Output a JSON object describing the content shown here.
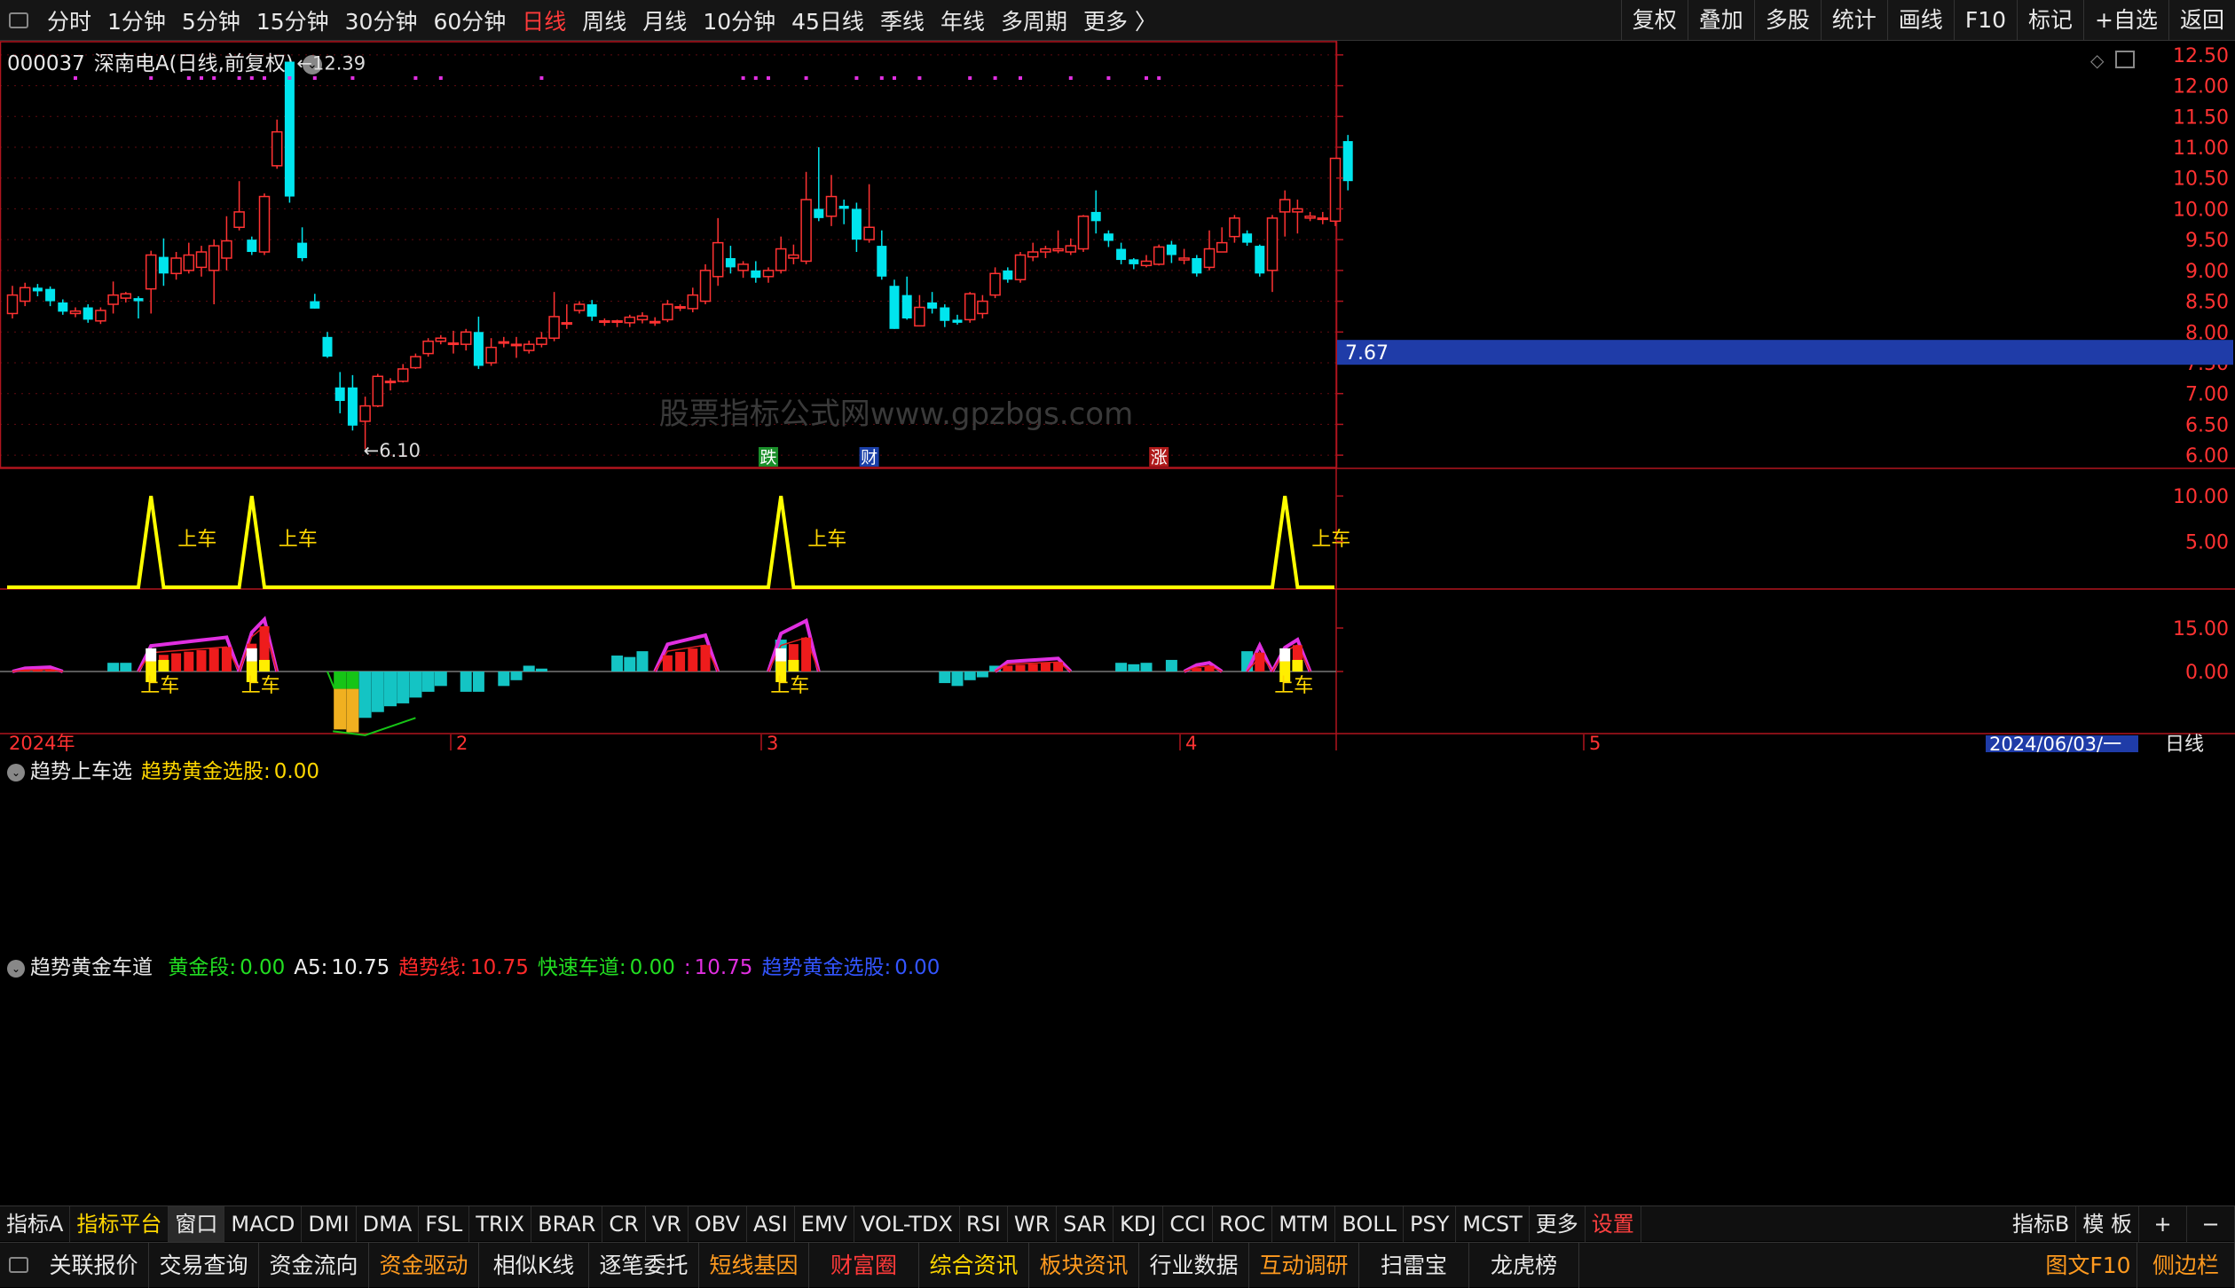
{
  "topbar": {
    "periods": [
      "分时",
      "1分钟",
      "5分钟",
      "15分钟",
      "30分钟",
      "60分钟",
      "日线",
      "周线",
      "月线",
      "10分钟",
      "45日线",
      "季线",
      "年线",
      "多周期",
      "更多 〉"
    ],
    "active_period": "日线",
    "right_buttons": [
      "复权",
      "叠加",
      "多股",
      "统计",
      "画线",
      "F10",
      "标记",
      "+自选",
      "返回"
    ]
  },
  "main_chart": {
    "code": "000037",
    "name": "深南电A",
    "mode": "(日线,前复权)",
    "high_mark": "12.39",
    "low_mark": "6.10",
    "current_price_tag": "7.67",
    "watermark": "股票指标公式网www.gpzbgs.com",
    "event_tags": [
      {
        "text": "跌",
        "color": "#1a8f2a",
        "index": 60
      },
      {
        "text": "财",
        "color": "#1a3fa8",
        "index": 68
      },
      {
        "text": "涨",
        "color": "#b01a1a",
        "index": 91
      }
    ],
    "price_ticks": [
      "12.50",
      "12.00",
      "11.50",
      "11.00",
      "10.50",
      "10.00",
      "9.50",
      "9.00",
      "8.50",
      "8.00",
      "7.50",
      "7.00",
      "6.50",
      "6.00"
    ],
    "colors": {
      "up": "#ff3232",
      "down": "#00e5ee",
      "axis": "#b0141e",
      "magenta": "#e02fe0"
    }
  },
  "panel1": {
    "title": "趋势上车选",
    "label": "趋势黄金选股:",
    "value": "0.00",
    "signal_text": "上车",
    "y_ticks": [
      "10.00",
      "5.00"
    ],
    "line_color": "#ffff00"
  },
  "panel2": {
    "title": "趋势黄金车道",
    "items": [
      {
        "label": "黄金段:",
        "value": "0.00",
        "color": "#22dd22"
      },
      {
        "label": "A5:",
        "value": "10.75",
        "color": "#f0f0f0"
      },
      {
        "label": "趋势线:",
        "value": "10.75",
        "color": "#ff2a2a"
      },
      {
        "label": "快速车道:",
        "value": "0.00",
        "color": "#22dd22"
      },
      {
        "label": ":",
        "value": "10.75",
        "color": "#e02fe0"
      },
      {
        "label": "趋势黄金选股:",
        "value": "0.00",
        "color": "#3355ff"
      }
    ],
    "signal_text": "上车",
    "y_ticks": [
      "15.00",
      "0.00"
    ]
  },
  "date_axis": {
    "labels": [
      "2024年",
      "2",
      "3",
      "4",
      "5"
    ],
    "current_date": "2024/06/03/一",
    "period_label": "日线"
  },
  "indicator_bar": {
    "items": [
      "指标A",
      "指标平台",
      "窗口",
      "MACD",
      "DMI",
      "DMA",
      "FSL",
      "TRIX",
      "BRAR",
      "CR",
      "VR",
      "OBV",
      "ASI",
      "EMV",
      "VOL-TDX",
      "RSI",
      "WR",
      "SAR",
      "KDJ",
      "CCI",
      "ROC",
      "MTM",
      "BOLL",
      "PSY",
      "MCST",
      "更多",
      "设置"
    ],
    "right_items": [
      "指标B",
      "模 板",
      "+",
      "−"
    ]
  },
  "bottom_bar": {
    "items": [
      "关联报价",
      "交易查询",
      "资金流向",
      "资金驱动",
      "相似K线",
      "逐笔委托",
      "短线基因",
      "财富圈",
      "综合资讯",
      "板块资讯",
      "行业数据",
      "互动调研",
      "扫雷宝",
      "龙虎榜"
    ],
    "right_items": [
      "图文F10",
      "侧边栏"
    ]
  },
  "chart_data": {
    "type": "candlestick",
    "title": "000037 深南电A (日线,前复权)",
    "y_range": [
      5.8,
      12.7
    ],
    "candles": [
      [
        8.3,
        8.6,
        8.75,
        8.22
      ],
      [
        8.5,
        8.72,
        8.8,
        8.42
      ],
      [
        8.72,
        8.66,
        8.78,
        8.58
      ],
      [
        8.7,
        8.5,
        8.74,
        8.42
      ],
      [
        8.48,
        8.33,
        8.53,
        8.28
      ],
      [
        8.3,
        8.34,
        8.4,
        8.24
      ],
      [
        8.4,
        8.2,
        8.45,
        8.15
      ],
      [
        8.18,
        8.35,
        8.4,
        8.13
      ],
      [
        8.45,
        8.6,
        8.82,
        8.3
      ],
      [
        8.55,
        8.62,
        8.65,
        8.48
      ],
      [
        8.55,
        8.5,
        8.58,
        8.22
      ],
      [
        8.7,
        9.25,
        9.32,
        8.3
      ],
      [
        9.22,
        8.95,
        9.52,
        8.75
      ],
      [
        8.95,
        9.2,
        9.3,
        8.85
      ],
      [
        9.0,
        9.25,
        9.45,
        8.95
      ],
      [
        9.05,
        9.3,
        9.4,
        8.9
      ],
      [
        9.0,
        9.4,
        9.5,
        8.45
      ],
      [
        9.2,
        9.48,
        9.88,
        9.0
      ],
      [
        9.7,
        9.95,
        10.45,
        9.65
      ],
      [
        9.5,
        9.3,
        9.55,
        9.25
      ],
      [
        9.3,
        10.2,
        10.25,
        9.25
      ],
      [
        10.7,
        11.25,
        11.45,
        10.65
      ],
      [
        12.39,
        10.2,
        12.39,
        10.1
      ],
      [
        9.45,
        9.2,
        9.7,
        9.15
      ],
      [
        8.5,
        8.38,
        8.62,
        8.38
      ],
      [
        7.92,
        7.6,
        8.0,
        7.58
      ],
      [
        7.1,
        6.88,
        7.35,
        6.68
      ],
      [
        7.1,
        6.48,
        7.3,
        6.4
      ],
      [
        6.55,
        6.8,
        6.95,
        6.1
      ],
      [
        6.8,
        7.28,
        7.32,
        6.78
      ],
      [
        7.2,
        7.2,
        7.25,
        7.05
      ],
      [
        7.2,
        7.4,
        7.48,
        7.18
      ],
      [
        7.42,
        7.6,
        7.65,
        7.4
      ],
      [
        7.65,
        7.85,
        7.9,
        7.6
      ],
      [
        7.85,
        7.9,
        7.95,
        7.8
      ],
      [
        7.82,
        7.82,
        8.02,
        7.65
      ],
      [
        7.8,
        8.0,
        8.05,
        7.7
      ],
      [
        8.0,
        7.45,
        8.25,
        7.4
      ],
      [
        7.5,
        7.75,
        7.9,
        7.45
      ],
      [
        7.82,
        7.84,
        7.92,
        7.75
      ],
      [
        7.8,
        7.8,
        7.92,
        7.58
      ],
      [
        7.7,
        7.8,
        7.86,
        7.65
      ],
      [
        7.8,
        7.9,
        8.0,
        7.75
      ],
      [
        7.9,
        8.25,
        8.65,
        7.85
      ],
      [
        8.15,
        8.15,
        8.45,
        8.05
      ],
      [
        8.35,
        8.45,
        8.5,
        8.3
      ],
      [
        8.45,
        8.25,
        8.52,
        8.18
      ],
      [
        8.18,
        8.18,
        8.22,
        8.1
      ],
      [
        8.18,
        8.18,
        8.2,
        8.08
      ],
      [
        8.15,
        8.24,
        8.28,
        8.08
      ],
      [
        8.2,
        8.26,
        8.32,
        8.14
      ],
      [
        8.17,
        8.17,
        8.24,
        8.1
      ],
      [
        8.2,
        8.45,
        8.52,
        8.16
      ],
      [
        8.4,
        8.41,
        8.45,
        8.34
      ],
      [
        8.38,
        8.6,
        8.72,
        8.32
      ],
      [
        8.5,
        9.0,
        9.1,
        8.45
      ],
      [
        8.9,
        9.45,
        9.85,
        8.75
      ],
      [
        9.2,
        9.05,
        9.4,
        8.95
      ],
      [
        9.0,
        9.1,
        9.15,
        8.88
      ],
      [
        9.0,
        8.88,
        9.15,
        8.8
      ],
      [
        8.9,
        9.0,
        9.05,
        8.8
      ],
      [
        9.0,
        9.35,
        9.55,
        8.95
      ],
      [
        9.2,
        9.25,
        9.42,
        9.1
      ],
      [
        9.15,
        10.15,
        10.6,
        9.1
      ],
      [
        10.0,
        9.85,
        11.0,
        9.8
      ],
      [
        9.88,
        10.2,
        10.55,
        9.72
      ],
      [
        10.05,
        10.0,
        10.15,
        9.75
      ],
      [
        10.0,
        9.5,
        10.1,
        9.3
      ],
      [
        9.5,
        9.7,
        10.4,
        9.45
      ],
      [
        9.4,
        8.9,
        9.65,
        8.85
      ],
      [
        8.75,
        8.05,
        8.85,
        8.05
      ],
      [
        8.6,
        8.22,
        8.9,
        8.2
      ],
      [
        8.1,
        8.4,
        8.6,
        8.1
      ],
      [
        8.48,
        8.38,
        8.65,
        8.3
      ],
      [
        8.4,
        8.18,
        8.45,
        8.08
      ],
      [
        8.2,
        8.15,
        8.28,
        8.12
      ],
      [
        8.2,
        8.62,
        8.65,
        8.15
      ],
      [
        8.3,
        8.5,
        8.6,
        8.22
      ],
      [
        8.6,
        8.95,
        9.05,
        8.55
      ],
      [
        9.0,
        8.85,
        9.05,
        8.8
      ],
      [
        8.85,
        9.25,
        9.3,
        8.8
      ],
      [
        9.22,
        9.3,
        9.45,
        9.15
      ],
      [
        9.3,
        9.35,
        9.4,
        9.2
      ],
      [
        9.32,
        9.35,
        9.65,
        9.28
      ],
      [
        9.3,
        9.4,
        9.52,
        9.25
      ],
      [
        9.35,
        9.88,
        9.9,
        9.3
      ],
      [
        9.95,
        9.8,
        10.3,
        9.6
      ],
      [
        9.6,
        9.48,
        9.65,
        9.38
      ],
      [
        9.35,
        9.17,
        9.45,
        9.1
      ],
      [
        9.18,
        9.1,
        9.2,
        9.02
      ],
      [
        9.08,
        9.15,
        9.25,
        9.05
      ],
      [
        9.1,
        9.38,
        9.42,
        9.08
      ],
      [
        9.42,
        9.25,
        9.48,
        9.12
      ],
      [
        9.17,
        9.2,
        9.35,
        9.1
      ],
      [
        9.2,
        8.95,
        9.25,
        8.9
      ],
      [
        9.05,
        9.35,
        9.65,
        9.0
      ],
      [
        9.3,
        9.45,
        9.7,
        9.3
      ],
      [
        9.55,
        9.85,
        9.9,
        9.45
      ],
      [
        9.6,
        9.45,
        9.65,
        9.4
      ],
      [
        9.4,
        8.95,
        9.42,
        8.9
      ],
      [
        9.0,
        9.85,
        9.9,
        8.65
      ],
      [
        9.95,
        10.15,
        10.3,
        9.55
      ],
      [
        9.95,
        10.0,
        10.15,
        9.6
      ],
      [
        9.85,
        9.88,
        9.95,
        9.8
      ],
      [
        9.85,
        9.85,
        9.95,
        9.75
      ],
      [
        9.8,
        10.82,
        10.82,
        9.72
      ],
      [
        11.1,
        10.45,
        11.2,
        10.3
      ]
    ],
    "candle_format": [
      "open",
      "close",
      "high",
      "low"
    ],
    "magenta_dot_indices": [
      5,
      11,
      14,
      15,
      16,
      18,
      19,
      20,
      22,
      24,
      27,
      32,
      34,
      42,
      58,
      59,
      60,
      63,
      67,
      69,
      70,
      72,
      76,
      78,
      80,
      84,
      87,
      90,
      91
    ]
  },
  "panel1_data": {
    "type": "line",
    "y_range": [
      0,
      10.5
    ],
    "spike_indices": [
      11,
      19,
      61,
      101
    ],
    "spike_value": 10
  },
  "panel2_data": {
    "type": "bar",
    "y_range": [
      -22,
      20
    ],
    "segments": [
      {
        "start": 1,
        "end": 3,
        "red": 0.5,
        "magenta": 1.5
      },
      {
        "start": 11,
        "end": 17,
        "red": 6.5,
        "magenta": 11.8
      },
      {
        "start": 19,
        "end": 20,
        "red": 12,
        "magenta": 18
      },
      {
        "start": 52,
        "end": 55,
        "red": 7,
        "magenta": 12.5
      },
      {
        "start": 61,
        "end": 63,
        "red": 9,
        "magenta": 17.5
      },
      {
        "start": 79,
        "end": 83,
        "red": 2.5,
        "magenta": 4.5
      },
      {
        "start": 94,
        "end": 95,
        "red": 1.5,
        "magenta": 3
      },
      {
        "start": 99,
        "end": 99,
        "red": 5,
        "magenta": 9
      },
      {
        "start": 101,
        "end": 102,
        "red": 7,
        "magenta": 11
      }
    ],
    "cyan_values": [
      [
        8,
        3
      ],
      [
        9,
        3
      ],
      [
        48,
        5.5
      ],
      [
        49,
        5
      ],
      [
        50,
        7
      ],
      [
        61,
        11
      ],
      [
        74,
        -4
      ],
      [
        75,
        -5
      ],
      [
        76,
        -3
      ],
      [
        77,
        -2
      ],
      [
        78,
        2
      ],
      [
        88,
        3
      ],
      [
        89,
        2.5
      ],
      [
        90,
        3
      ],
      [
        92,
        4
      ],
      [
        98,
        7
      ]
    ],
    "negative_block": {
      "start": 25,
      "end": 34,
      "values": [
        -6,
        -20,
        -21,
        -16,
        -14,
        -12,
        -11,
        -9,
        -7,
        -5
      ]
    },
    "neg_late": [
      [
        36,
        -7
      ],
      [
        37,
        -7
      ],
      [
        39,
        -5
      ],
      [
        40,
        -3
      ],
      [
        41,
        2
      ],
      [
        42,
        1
      ]
    ],
    "shangche_indices": [
      11,
      19,
      61,
      101
    ]
  }
}
